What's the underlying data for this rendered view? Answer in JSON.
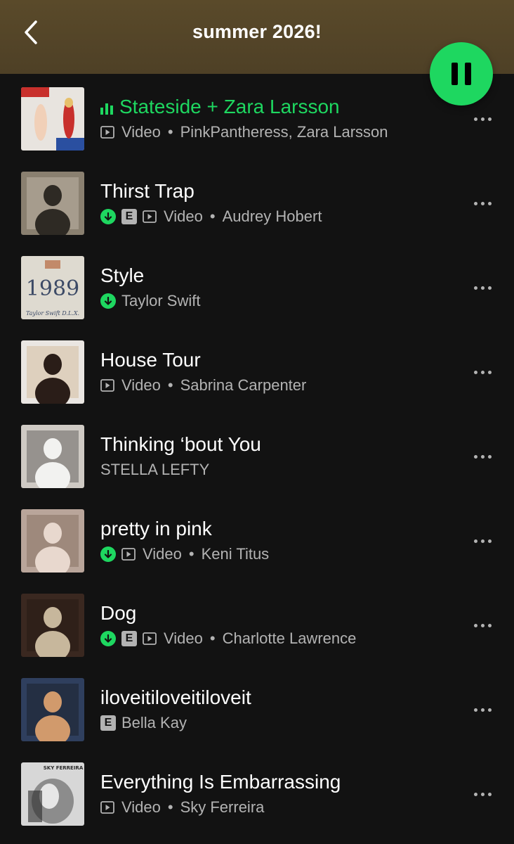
{
  "header": {
    "title": "summer 2026!",
    "background": "#56472a",
    "accent": "#1ed760"
  },
  "controls": {
    "back_icon": "chevron-left-icon",
    "play_icon": "pause-icon",
    "more_icon": "more-horizontal-icon"
  },
  "tracks": [
    {
      "title": "Stateside + Zara Larsson",
      "playing": true,
      "download": false,
      "explicit": false,
      "video": true,
      "video_label": "Video",
      "artist": "PinkPantheress, Zara Larsson"
    },
    {
      "title": "Thirst Trap",
      "playing": false,
      "download": true,
      "explicit": true,
      "video": true,
      "video_label": "Video",
      "artist": "Audrey Hobert"
    },
    {
      "title": "Style",
      "playing": false,
      "download": true,
      "explicit": false,
      "video": false,
      "artist": "Taylor Swift"
    },
    {
      "title": "House Tour",
      "playing": false,
      "download": false,
      "explicit": false,
      "video": true,
      "video_label": "Video",
      "artist": "Sabrina Carpenter"
    },
    {
      "title": "Thinking ‘bout You",
      "playing": false,
      "download": false,
      "explicit": false,
      "video": false,
      "artist": "STELLA LEFTY"
    },
    {
      "title": "pretty in pink",
      "playing": false,
      "download": true,
      "explicit": false,
      "video": true,
      "video_label": "Video",
      "artist": "Keni Titus"
    },
    {
      "title": "Dog",
      "playing": false,
      "download": true,
      "explicit": true,
      "video": true,
      "video_label": "Video",
      "artist": "Charlotte Lawrence"
    },
    {
      "title": "iloveitiloveitiloveit",
      "playing": false,
      "download": false,
      "explicit": true,
      "video": false,
      "artist": "Bella Kay"
    },
    {
      "title": "Everything Is Embarrassing",
      "playing": false,
      "download": false,
      "explicit": false,
      "video": true,
      "video_label": "Video",
      "artist": "Sky Ferreira"
    }
  ],
  "artwork": [
    {
      "bg": "#e8e4df",
      "fg": "#c8302c",
      "fg2": "#2a4fa0",
      "text": ""
    },
    {
      "bg": "#8a8070",
      "fg": "#2e2a24",
      "fg2": "#d9d2c4",
      "text": ""
    },
    {
      "bg": "#dedad0",
      "fg": "#3c4a66",
      "fg2": "#c28a6a",
      "text": "1989",
      "subtext": "Taylor Swift D.L.X."
    },
    {
      "bg": "#eae6e2",
      "fg": "#2a1d18",
      "fg2": "#c9a57a",
      "text": ""
    },
    {
      "bg": "#cfcac4",
      "fg": "#f2f2f0",
      "fg2": "#2b2b2b",
      "text": ""
    },
    {
      "bg": "#b9a59a",
      "fg": "#e8d8ce",
      "fg2": "#6e5546",
      "text": ""
    },
    {
      "bg": "#3a2820",
      "fg": "#c7b79c",
      "fg2": "#1c120e",
      "text": ""
    },
    {
      "bg": "#2f3f5e",
      "fg": "#d19a6c",
      "fg2": "#111111",
      "text": ""
    },
    {
      "bg": "#d7d7d7",
      "fg": "#2a2a2a",
      "fg2": "#8c8c8c",
      "text": "SKY FERREIRA"
    }
  ],
  "artwork_icon": "album-art"
}
